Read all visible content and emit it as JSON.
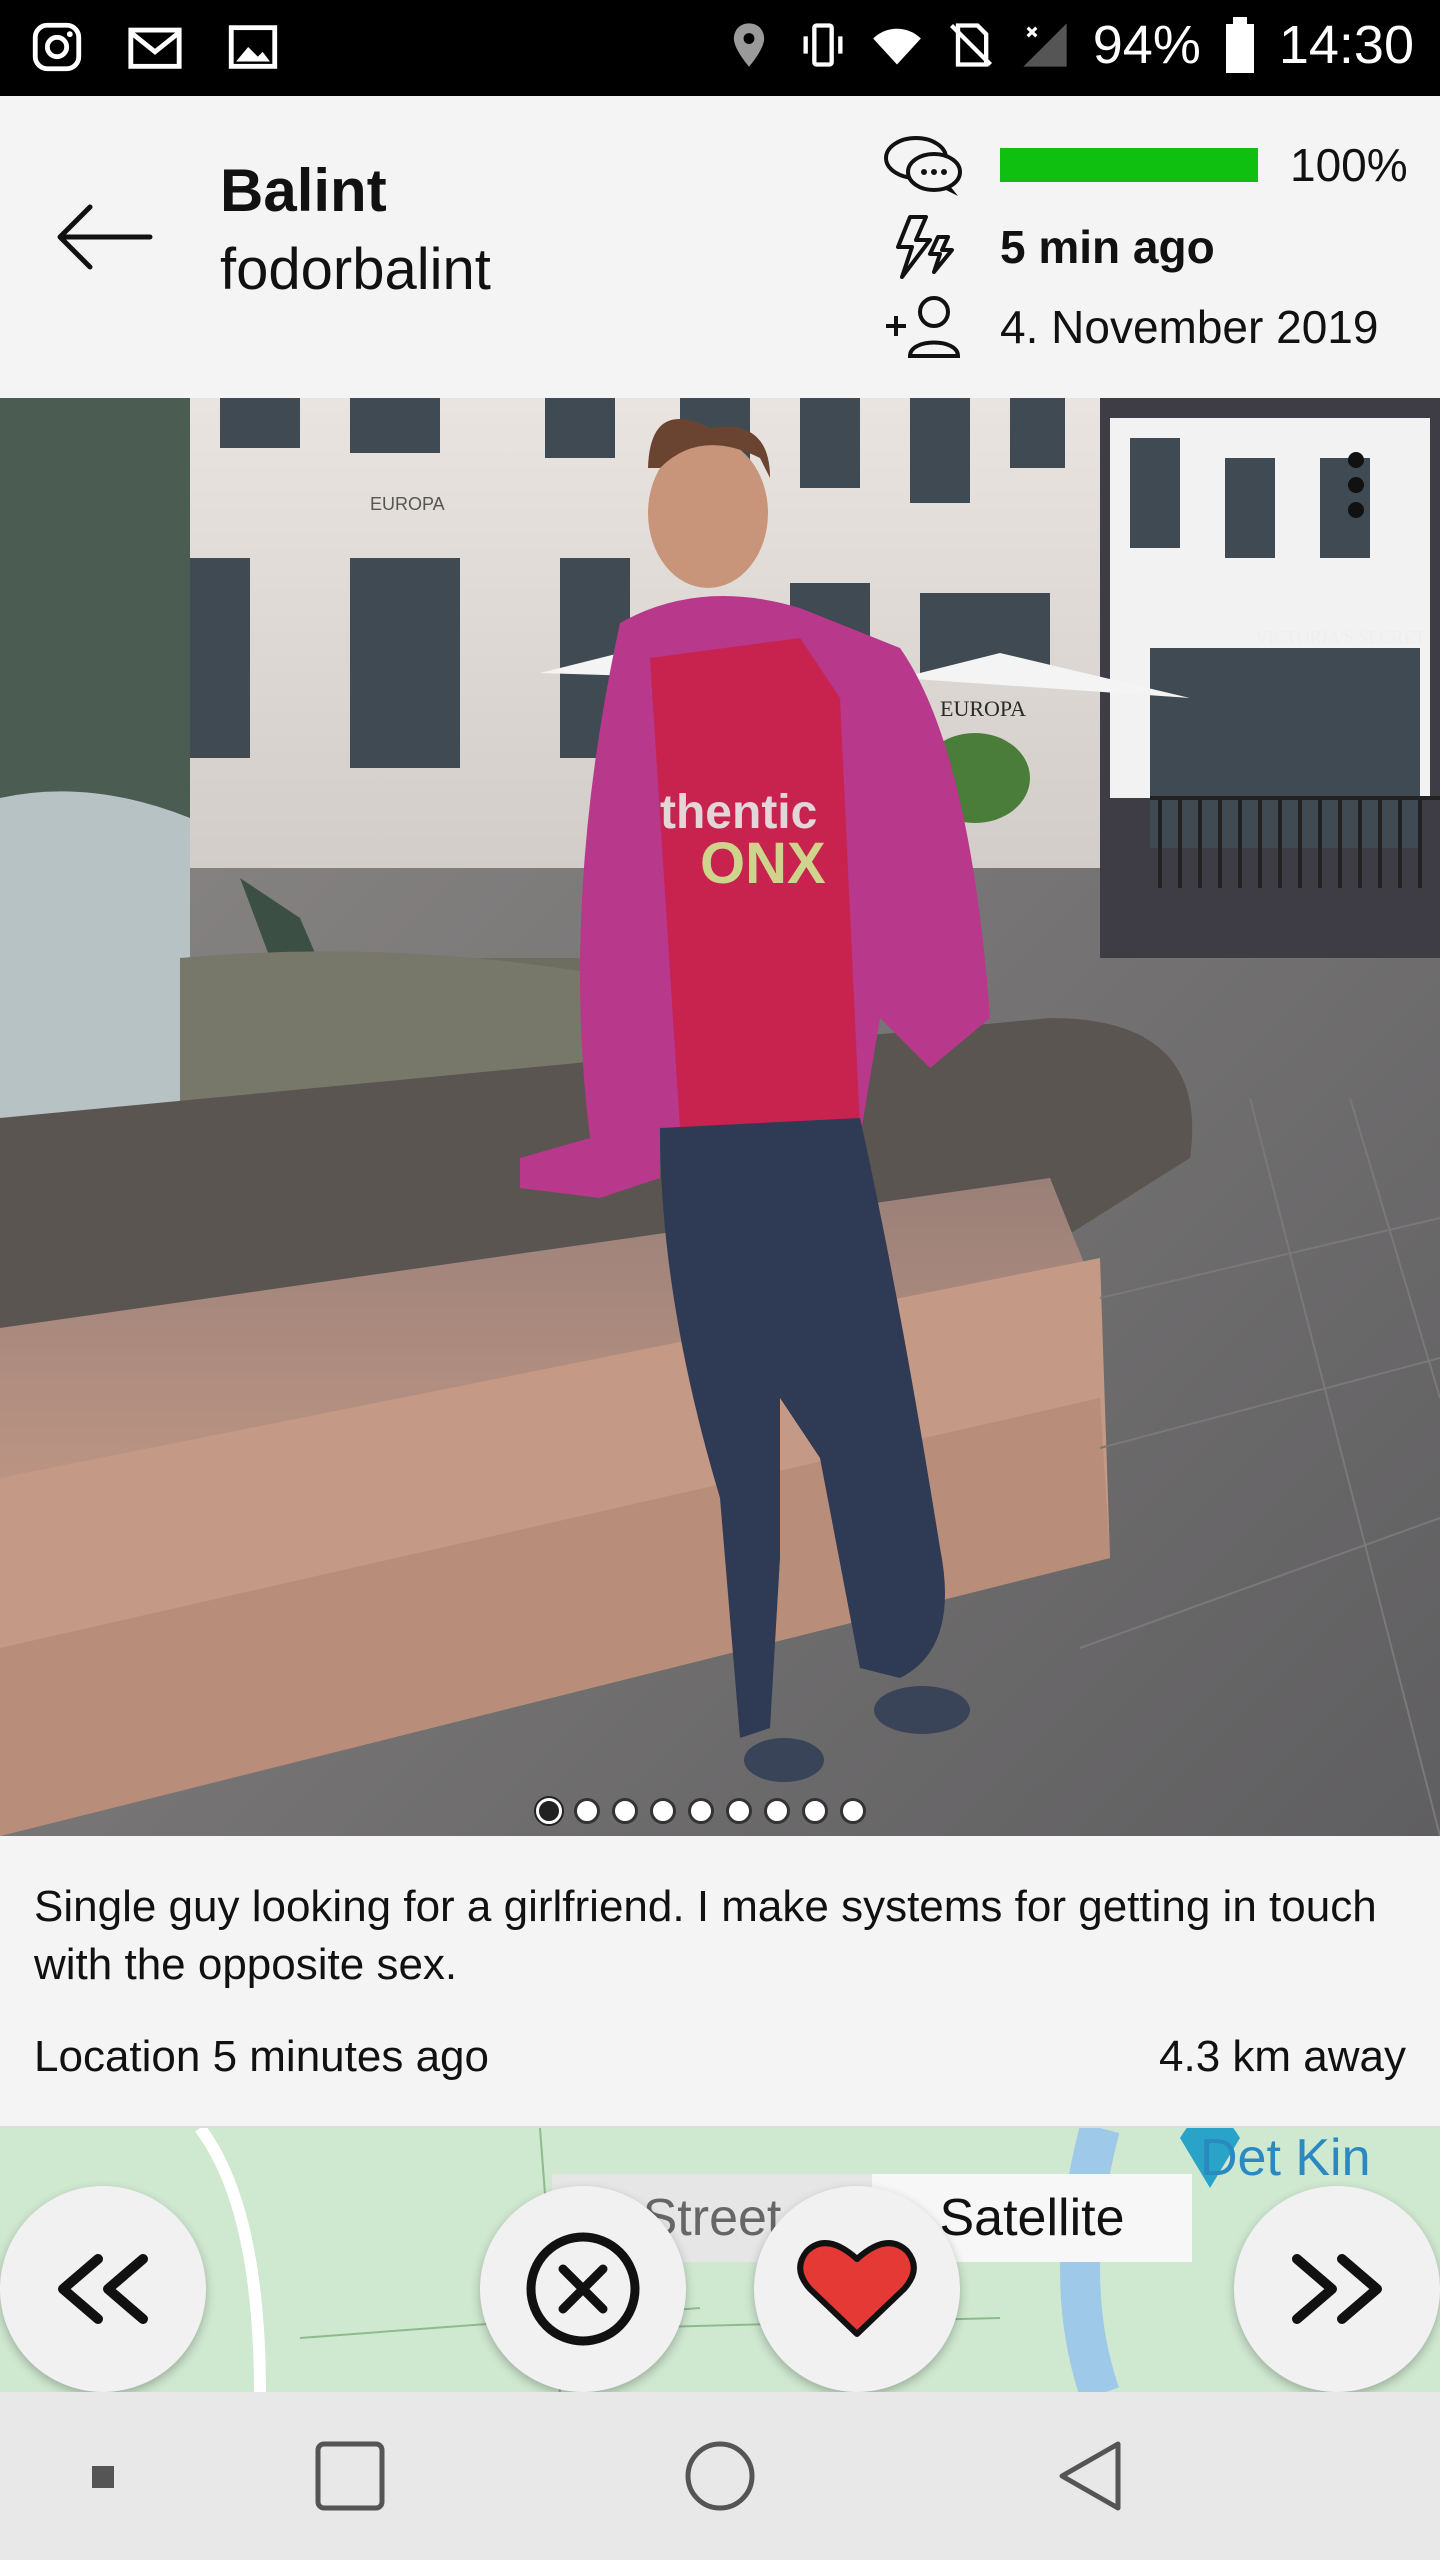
{
  "status_bar": {
    "battery": "94%",
    "time": "14:30",
    "left_icons": [
      "instagram-icon",
      "gmail-icon",
      "gallery-icon"
    ],
    "right_icons": [
      "location-icon",
      "vibrate-icon",
      "wifi-icon",
      "no-sim-icon",
      "signal-icon",
      "battery-icon"
    ]
  },
  "header": {
    "name": "Balint",
    "username": "fodorbalint",
    "response_rate": 100,
    "response_label": "100%",
    "last_active": "5 min ago",
    "registered": "4. November 2019",
    "bar_color": "#10c010"
  },
  "photo": {
    "count": 9,
    "active_index": 0
  },
  "profile": {
    "bio": "Single guy looking for a girlfriend. I make systems for getting in touch with the opposite sex.",
    "location_time": "Location 5 minutes ago",
    "distance": "4.3 km away"
  },
  "map": {
    "street_label": "Street",
    "satellite_label": "Satellite",
    "place_label": "Det Kin"
  },
  "actions": {
    "prev_icon": "double-chevron-left-icon",
    "dismiss_icon": "close-circle-icon",
    "like_icon": "heart-icon",
    "next_icon": "double-chevron-right-icon",
    "like_color": "#e53935"
  }
}
